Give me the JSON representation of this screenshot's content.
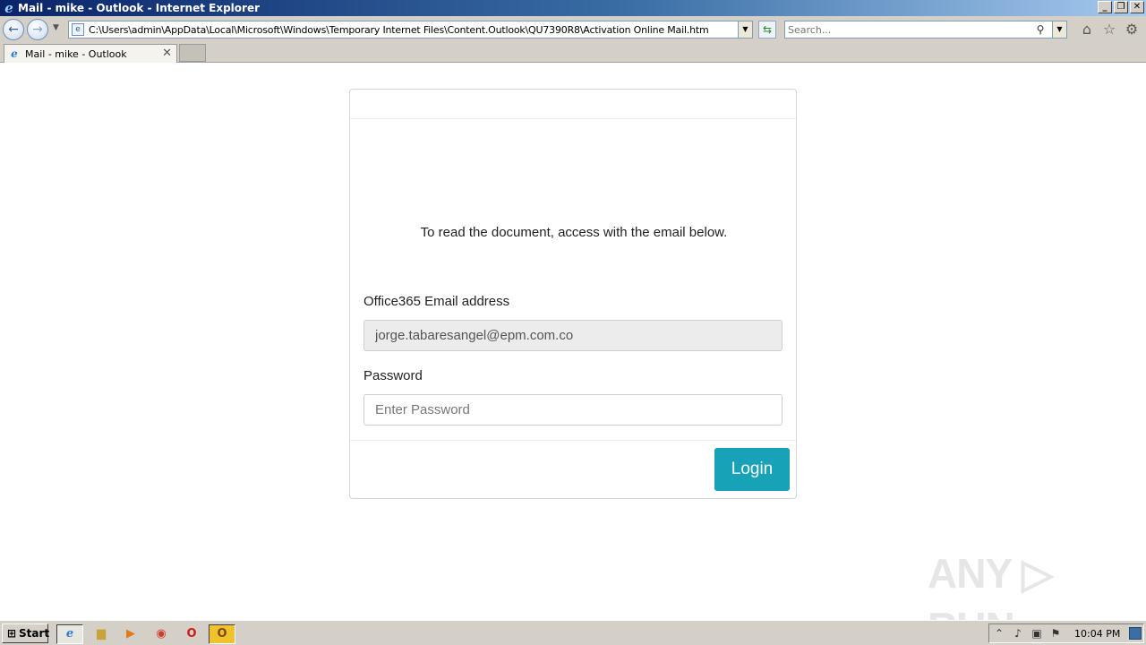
{
  "window": {
    "title": "Mail - mike - Outlook - Internet Explorer",
    "min_glyph": "_",
    "restore_glyph": "❐",
    "close_glyph": "✕"
  },
  "nav": {
    "back_glyph": "←",
    "forward_glyph": "→",
    "dropdown_glyph": "▼",
    "address_value": "C:\\Users\\admin\\AppData\\Local\\Microsoft\\Windows\\Temporary Internet Files\\Content.Outlook\\QU7390R8\\Activation Online Mail.htm",
    "refresh_glyph": "⇆",
    "search_placeholder": "Search...",
    "search_glyph": "⚲"
  },
  "toolbar_icons": {
    "home": "⌂",
    "favorites": "☆",
    "tools": "⚙"
  },
  "tab": {
    "label": "Mail - mike - Outlook",
    "close_glyph": "✕"
  },
  "page": {
    "message": "To read the document, access with the email below.",
    "email_label": "Office365 Email address",
    "email_value": "jorge.tabaresangel@epm.com.co",
    "password_label": "Password",
    "password_placeholder": "Enter Password",
    "login_label": "Login"
  },
  "watermark": {
    "text": "ANY ▷ RUN"
  },
  "taskbar": {
    "start_label": "Start",
    "clock": "10:04 PM"
  },
  "colors": {
    "login_button": "#17a2b8",
    "titlebar_start": "#0a246a",
    "titlebar_end": "#a6caf0"
  }
}
